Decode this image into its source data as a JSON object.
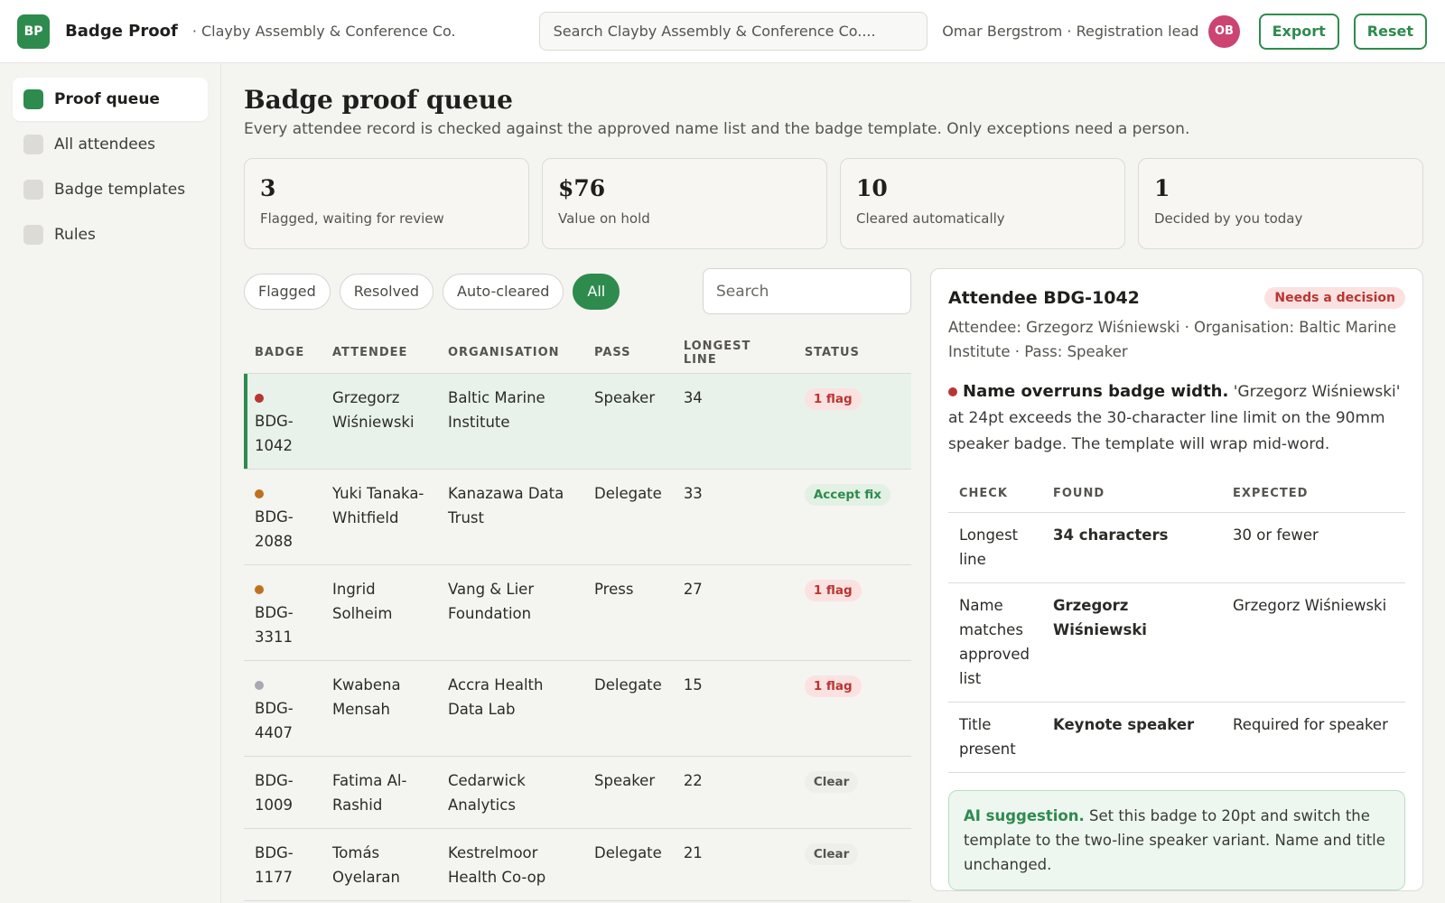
{
  "header": {
    "logo": "BP",
    "app_title": "Badge Proof",
    "org": "· Clayby Assembly & Conference Co.",
    "search_placeholder": "Search Clayby Assembly & Conference Co....",
    "user": "Omar Bergstrom · Registration lead",
    "avatar": "OB",
    "export_label": "Export",
    "reset_label": "Reset"
  },
  "sidebar": {
    "items": [
      {
        "label": "Proof queue"
      },
      {
        "label": "All attendees"
      },
      {
        "label": "Badge templates"
      },
      {
        "label": "Rules"
      }
    ]
  },
  "main": {
    "title": "Badge proof queue",
    "subtitle": "Every attendee record is checked against the approved name list and the badge template. Only exceptions need a person."
  },
  "stats": [
    {
      "value": "3",
      "label": "Flagged, waiting for review"
    },
    {
      "value": "$76",
      "label": "Value on hold"
    },
    {
      "value": "10",
      "label": "Cleared automatically"
    },
    {
      "value": "1",
      "label": "Decided by you today"
    }
  ],
  "filters": {
    "chips": [
      "Flagged",
      "Resolved",
      "Auto-cleared",
      "All"
    ],
    "search_placeholder": "Search"
  },
  "queue": {
    "columns": [
      "BADGE",
      "ATTENDEE",
      "ORGANISATION",
      "PASS",
      "LONGEST LINE",
      "STATUS"
    ],
    "rows": [
      {
        "badge": "BDG-1042",
        "attendee": "Grzegorz Wiśniewski",
        "org": "Baltic Marine Institute",
        "pass": "Speaker",
        "longest": "34",
        "status": "1 flag"
      },
      {
        "badge": "BDG-2088",
        "attendee": "Yuki Tanaka-Whitfield",
        "org": "Kanazawa Data Trust",
        "pass": "Delegate",
        "longest": "33",
        "status": "Accept fix"
      },
      {
        "badge": "BDG-3311",
        "attendee": "Ingrid Solheim",
        "org": "Vang & Lier Foundation",
        "pass": "Press",
        "longest": "27",
        "status": "1 flag"
      },
      {
        "badge": "BDG-4407",
        "attendee": "Kwabena Mensah",
        "org": "Accra Health Data Lab",
        "pass": "Delegate",
        "longest": "15",
        "status": "1 flag"
      },
      {
        "badge": "BDG-1009",
        "attendee": "Fatima Al-Rashid",
        "org": "Cedarwick Analytics",
        "pass": "Speaker",
        "longest": "22",
        "status": "Clear"
      },
      {
        "badge": "BDG-1177",
        "attendee": "Tomás Oyelaran",
        "org": "Kestrelmoor Health Co-op",
        "pass": "Delegate",
        "longest": "21",
        "status": "Clear"
      }
    ]
  },
  "colors": {
    "accent": "#2e8b4e",
    "flag": "#b83632",
    "dot_red": "#b83632",
    "dot_orange": "#c07020",
    "dot_grey": "#a9a8b4"
  },
  "detail": {
    "title": "Attendee BDG-1042",
    "badge": "Needs a decision",
    "meta": "Attendee: Grzegorz Wiśniewski · Organisation: Baltic Marine Institute · Pass: Speaker",
    "issue_title": "Name overruns badge width.",
    "issue_text": " 'Grzegorz Wiśniewski' at 24pt exceeds the 30-character line limit on the 90mm speaker badge. The template will wrap mid-word.",
    "checks": {
      "columns": [
        "CHECK",
        "FOUND",
        "EXPECTED"
      ],
      "rows": [
        {
          "check": "Longest line",
          "found": "34 characters",
          "expected": "30 or fewer"
        },
        {
          "check": "Name matches approved list",
          "found": "Grzegorz Wiśniewski",
          "expected": "Grzegorz Wiśniewski"
        },
        {
          "check": "Title present",
          "found": "Keynote speaker",
          "expected": "Required for speaker"
        }
      ]
    },
    "suggestion_label": "AI suggestion.",
    "suggestion_text": " Set this badge to 20pt and switch the template to the two-line speaker variant. Name and title unchanged."
  }
}
